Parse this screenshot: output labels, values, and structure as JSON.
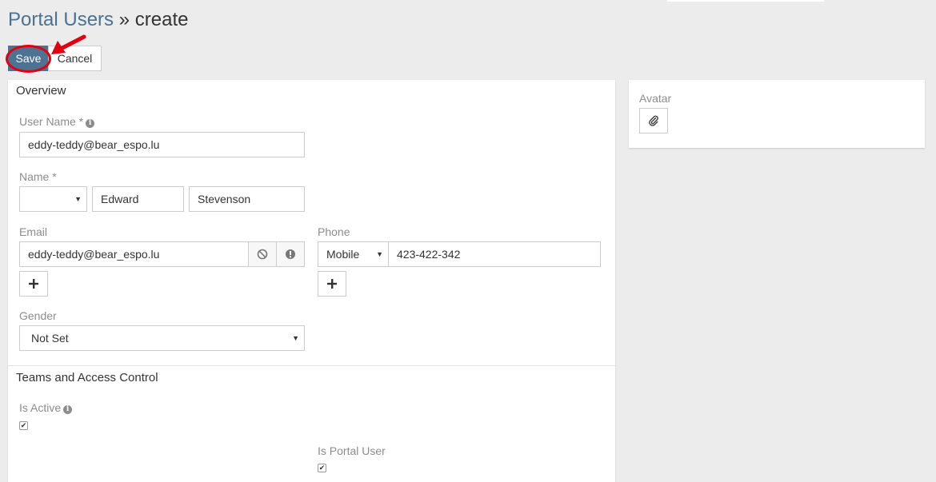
{
  "header": {
    "breadcrumb_link": "Portal Users",
    "separator": "»",
    "current": "create"
  },
  "toolbar": {
    "save_label": "Save",
    "cancel_label": "Cancel"
  },
  "overview": {
    "title": "Overview",
    "user_name": {
      "label": "User Name *",
      "value": "eddy-teddy@bear_espo.lu"
    },
    "name": {
      "label": "Name *",
      "salutation": "",
      "first": "Edward",
      "last": "Stevenson"
    },
    "email": {
      "label": "Email",
      "value": "eddy-teddy@bear_espo.lu"
    },
    "phone": {
      "label": "Phone",
      "type": "Mobile",
      "value": "423-422-342"
    },
    "gender": {
      "label": "Gender",
      "value": "Not Set"
    }
  },
  "access": {
    "title": "Teams and Access Control",
    "is_active": {
      "label": "Is Active",
      "checked": true
    },
    "is_portal_user": {
      "label": "Is Portal User",
      "checked": true
    }
  },
  "side": {
    "avatar_label": "Avatar"
  },
  "colors": {
    "primary": "#4d7292",
    "link": "#4a7292",
    "highlight": "#e3000f"
  }
}
